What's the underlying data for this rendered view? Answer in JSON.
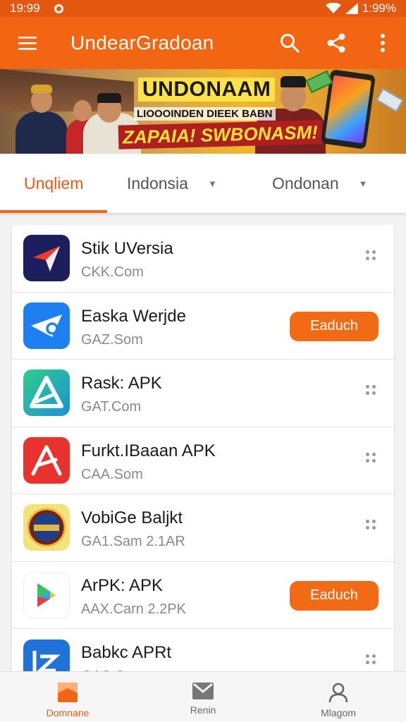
{
  "status_bar": {
    "time": "19:99",
    "battery_text": "1:99%"
  },
  "app_bar": {
    "title": "UndearGradoan",
    "icons": [
      "menu-icon",
      "search-icon",
      "share-icon",
      "more-vertical-icon"
    ]
  },
  "banner": {
    "headline": "UNDONAAM",
    "subline": "LIOOOINDEN DIEEK BABN",
    "promo": "ZAPAIA! SWBONASM!"
  },
  "tabs": [
    {
      "label": "Unqliem",
      "active": true
    },
    {
      "label": "Indonsia",
      "dropdown": true
    },
    {
      "label": "Ondonan",
      "dropdown": true
    }
  ],
  "apps": [
    {
      "name": "Stik UVersia",
      "sub": "CKK.Com",
      "icon": "send-arrow-icon",
      "icon_bg": "#1b1f5e",
      "action": "drag"
    },
    {
      "name": "Easka Werjde",
      "sub": "GAZ.Som",
      "icon": "paper-plane-icon",
      "icon_bg": "#1e7ff0",
      "action": "Eaduch"
    },
    {
      "name": "Rask: APK",
      "sub": "GAT.Com",
      "icon": "triangle-arrow-icon",
      "icon_bg": "#2fb4d8",
      "action": "drag"
    },
    {
      "name": "Furkt.IBaaan APK",
      "sub": "CAA.Som",
      "icon": "pen-a-icon",
      "icon_bg": "#e8322e",
      "action": "drag"
    },
    {
      "name": "VobiGe Baljkt",
      "sub": "GA1.Sam 2.1AR",
      "icon": "emblem-icon",
      "icon_bg": "#f6e27a",
      "action": "drag"
    },
    {
      "name": "ArPK: APK",
      "sub": "AAX.Carn 2.2PK",
      "icon": "google-play-icon",
      "icon_bg": "#ffffff",
      "action": "Eaduch"
    },
    {
      "name": "Babkc APRt",
      "sub": "GAS.Com",
      "icon": "bracket-z-icon",
      "icon_bg": "#1f72d8",
      "action": "drag"
    }
  ],
  "bottom_nav": [
    {
      "label": "Domnane",
      "icon": "home-icon",
      "active": true
    },
    {
      "label": "Renin",
      "icon": "mail-icon"
    },
    {
      "label": "Mlagom",
      "icon": "person-icon"
    }
  ],
  "colors": {
    "primary": "#f26513",
    "status_bar": "#e4570f",
    "accent_text": "#e85a10"
  }
}
